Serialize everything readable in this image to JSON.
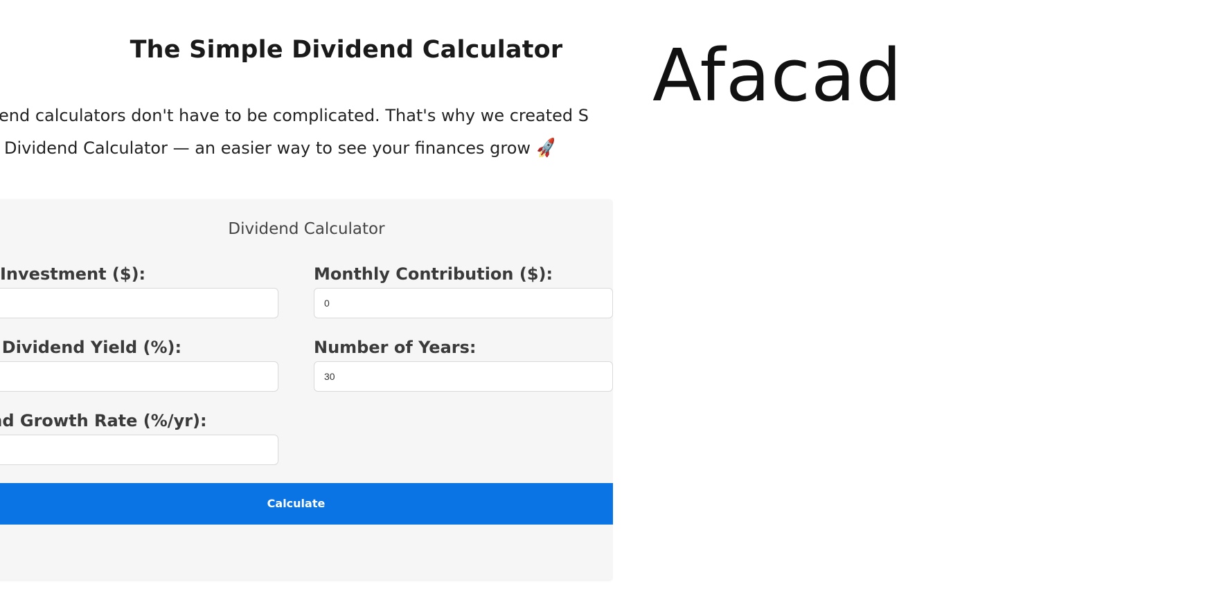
{
  "page": {
    "title": "The Simple Dividend Calculator",
    "intro_line_1": "end calculators don't have to be complicated. That's why we created S",
    "intro_line_2": "Dividend Calculator — an easier way to see your finances grow",
    "intro_icon": "rocket-icon"
  },
  "calculator": {
    "title": "Dividend Calculator",
    "fields": {
      "initial_investment": {
        "label": "Investment ($):",
        "value": ""
      },
      "monthly_contribution": {
        "label": "Monthly Contribution ($):",
        "value": "0"
      },
      "dividend_yield": {
        "label": "al Dividend Yield (%):",
        "value": ""
      },
      "number_of_years": {
        "label": "Number of Years:",
        "value": "30"
      },
      "growth_rate": {
        "label": "end Growth Rate (%/yr):",
        "value": ""
      }
    },
    "button_label": "Calculate",
    "accent_color": "#0b74e5"
  },
  "font_sample": {
    "text": "Afacad"
  }
}
